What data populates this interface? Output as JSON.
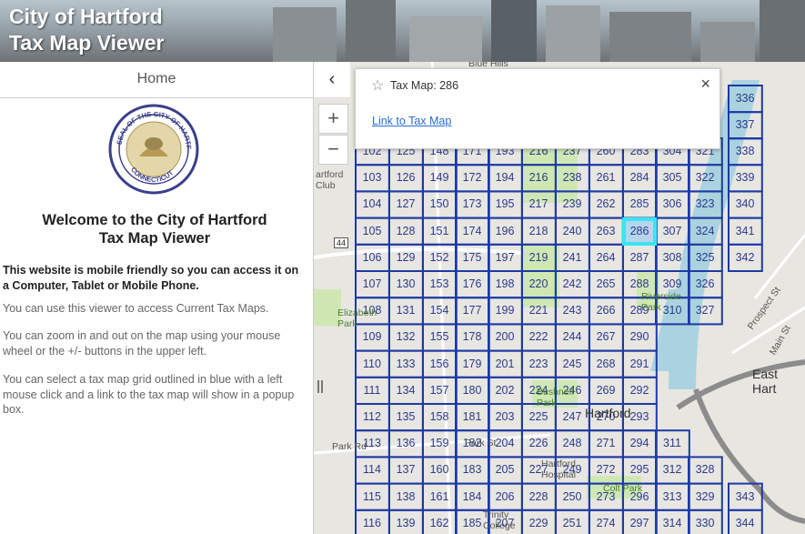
{
  "banner": {
    "title_line1": "City of Hartford",
    "title_line2": "Tax Map Viewer"
  },
  "sidebar": {
    "home_tab": "Home",
    "seal_top_text": "SEAL OF THE CITY OF HARTFORD",
    "seal_bottom_text": "CONNECTICUT",
    "welcome_line1": "Welcome to the City of Hartford",
    "welcome_line2": "Tax Map Viewer",
    "p1": "This website is mobile friendly so you can access it on a Computer, Tablet or Mobile Phone.",
    "p2": "You can use this viewer to access Current Tax Maps.",
    "p3": "You can zoom in and out on the map using your mouse wheel or the +/- buttons in the upper left.",
    "p4": "You can  select a tax map grid outlined in blue with a left mouse click and a link to the tax map will show in a popup box."
  },
  "map": {
    "collapse_icon": "chevron-left-icon",
    "zoom_in": "+",
    "zoom_out": "−",
    "popup": {
      "title": "Tax Map: 286",
      "link": "Link to Tax Map",
      "close": "×",
      "star": "☆"
    },
    "selected_cell": "286",
    "places": {
      "blue_hills": "Blue Hills",
      "hartford_club": "artford Club",
      "elizabeth_park": "Elizabeth Park",
      "riverside_park": "Riverside Park",
      "bushnell_park": "Bushnell Park",
      "hartford": "Hartford",
      "east_hartford": "East Hart",
      "park_st": "Park St",
      "park_rd": "Park Rd",
      "colt_park": "Colt Park",
      "main_st": "Main St",
      "prospect_st": "Prospect St",
      "hartford_hospital": "Hartford Hospital",
      "trinity_college": "Trinity College",
      "route_44": "44"
    },
    "grid_rows": [
      [
        "102",
        "125",
        "148",
        "171",
        "193",
        "216",
        "237",
        "260",
        "283",
        "304",
        "321",
        "338"
      ],
      [
        "103",
        "126",
        "149",
        "172",
        "194",
        "216",
        "238",
        "261",
        "284",
        "305",
        "322",
        "339"
      ],
      [
        "104",
        "127",
        "150",
        "173",
        "195",
        "217",
        "239",
        "262",
        "285",
        "306",
        "323",
        "340"
      ],
      [
        "105",
        "128",
        "151",
        "174",
        "196",
        "218",
        "240",
        "263",
        "286",
        "307",
        "324",
        "341"
      ],
      [
        "106",
        "129",
        "152",
        "175",
        "197",
        "219",
        "241",
        "264",
        "287",
        "308",
        "325",
        "342"
      ],
      [
        "107",
        "130",
        "153",
        "176",
        "198",
        "220",
        "242",
        "265",
        "288",
        "309",
        "326",
        ""
      ],
      [
        "108",
        "131",
        "154",
        "177",
        "199",
        "221",
        "243",
        "266",
        "289",
        "310",
        "327",
        ""
      ],
      [
        "109",
        "132",
        "155",
        "178",
        "200",
        "222",
        "244",
        "267",
        "290",
        "",
        "",
        ""
      ],
      [
        "110",
        "133",
        "156",
        "179",
        "201",
        "223",
        "245",
        "268",
        "291",
        "",
        "",
        ""
      ],
      [
        "111",
        "134",
        "157",
        "180",
        "202",
        "224",
        "246",
        "269",
        "292",
        "",
        "",
        ""
      ],
      [
        "112",
        "135",
        "158",
        "181",
        "203",
        "225",
        "247",
        "270",
        "293",
        "",
        "",
        ""
      ],
      [
        "113",
        "136",
        "159",
        "182",
        "204",
        "226",
        "248",
        "271",
        "294",
        "311",
        "",
        ""
      ],
      [
        "114",
        "137",
        "160",
        "183",
        "205",
        "227",
        "249",
        "272",
        "295",
        "312",
        "328",
        ""
      ],
      [
        "115",
        "138",
        "161",
        "184",
        "206",
        "228",
        "250",
        "273",
        "296",
        "313",
        "329",
        "343"
      ],
      [
        "116",
        "139",
        "162",
        "185",
        "207",
        "229",
        "251",
        "274",
        "297",
        "314",
        "330",
        "344"
      ]
    ],
    "top_right_cells": [
      "336",
      "337"
    ]
  }
}
